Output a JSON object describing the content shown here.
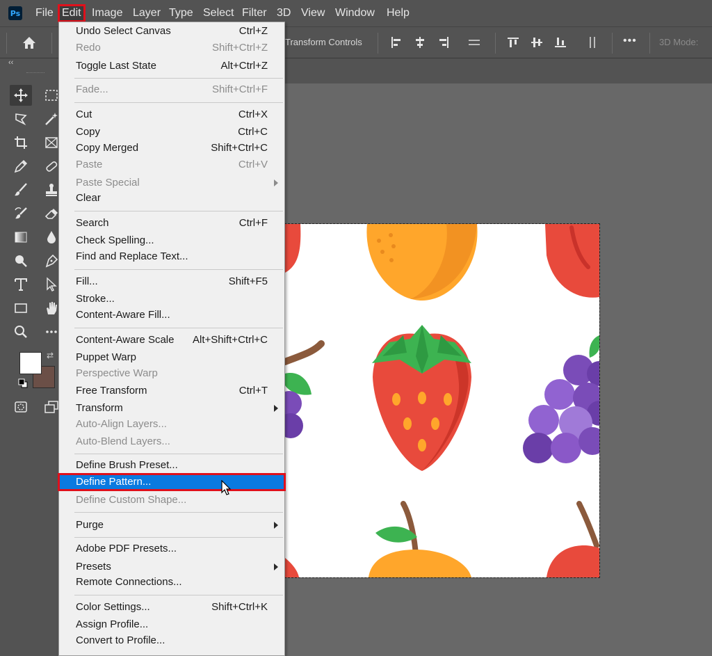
{
  "app": {
    "logo_text": "Ps"
  },
  "menubar": {
    "items": [
      "File",
      "Edit",
      "Image",
      "Layer",
      "Type",
      "Select",
      "Filter",
      "3D",
      "View",
      "Window",
      "Help"
    ],
    "active": "Edit"
  },
  "optionsbar": {
    "transform_controls": "Transform Controls",
    "more": "•••",
    "mode_3d": "3D Mode:"
  },
  "tabstrip": {
    "collapse": "‹‹"
  },
  "colors": {
    "foreground": "#ffffff",
    "background": "#6b4f47",
    "highlight": "#0a7ae0",
    "callout": "#e0101b"
  },
  "edit_menu": {
    "items": [
      {
        "label": "Undo Select Canvas",
        "shortcut": "Ctrl+Z",
        "disabled": false
      },
      {
        "label": "Redo",
        "shortcut": "Shift+Ctrl+Z",
        "disabled": true
      },
      {
        "label": "Toggle Last State",
        "shortcut": "Alt+Ctrl+Z",
        "disabled": false
      },
      {
        "label": "Fade...",
        "shortcut": "Shift+Ctrl+F",
        "disabled": true
      },
      {
        "label": "Cut",
        "shortcut": "Ctrl+X",
        "disabled": false
      },
      {
        "label": "Copy",
        "shortcut": "Ctrl+C",
        "disabled": false
      },
      {
        "label": "Copy Merged",
        "shortcut": "Shift+Ctrl+C",
        "disabled": false
      },
      {
        "label": "Paste",
        "shortcut": "Ctrl+V",
        "disabled": true
      },
      {
        "label": "Paste Special",
        "shortcut": "",
        "disabled": true,
        "submenu": true
      },
      {
        "label": "Clear",
        "shortcut": "",
        "disabled": false
      },
      {
        "label": "Search",
        "shortcut": "Ctrl+F",
        "disabled": false
      },
      {
        "label": "Check Spelling...",
        "shortcut": "",
        "disabled": false
      },
      {
        "label": "Find and Replace Text...",
        "shortcut": "",
        "disabled": false
      },
      {
        "label": "Fill...",
        "shortcut": "Shift+F5",
        "disabled": false
      },
      {
        "label": "Stroke...",
        "shortcut": "",
        "disabled": false
      },
      {
        "label": "Content-Aware Fill...",
        "shortcut": "",
        "disabled": false
      },
      {
        "label": "Content-Aware Scale",
        "shortcut": "Alt+Shift+Ctrl+C",
        "disabled": false
      },
      {
        "label": "Puppet Warp",
        "shortcut": "",
        "disabled": false
      },
      {
        "label": "Perspective Warp",
        "shortcut": "",
        "disabled": true
      },
      {
        "label": "Free Transform",
        "shortcut": "Ctrl+T",
        "disabled": false
      },
      {
        "label": "Transform",
        "shortcut": "",
        "disabled": false,
        "submenu": true
      },
      {
        "label": "Auto-Align Layers...",
        "shortcut": "",
        "disabled": true
      },
      {
        "label": "Auto-Blend Layers...",
        "shortcut": "",
        "disabled": true
      },
      {
        "label": "Define Brush Preset...",
        "shortcut": "",
        "disabled": false
      },
      {
        "label": "Define Pattern...",
        "shortcut": "",
        "disabled": false,
        "highlighted": true
      },
      {
        "label": "Define Custom Shape...",
        "shortcut": "",
        "disabled": true
      },
      {
        "label": "Purge",
        "shortcut": "",
        "disabled": false,
        "submenu": true
      },
      {
        "label": "Adobe PDF Presets...",
        "shortcut": "",
        "disabled": false
      },
      {
        "label": "Presets",
        "shortcut": "",
        "disabled": false,
        "submenu": true
      },
      {
        "label": "Remote Connections...",
        "shortcut": "",
        "disabled": false
      },
      {
        "label": "Color Settings...",
        "shortcut": "Shift+Ctrl+K",
        "disabled": false
      },
      {
        "label": "Assign Profile...",
        "shortcut": "",
        "disabled": false
      },
      {
        "label": "Convert to Profile...",
        "shortcut": "",
        "disabled": false
      }
    ]
  },
  "toolbar": {
    "tools": [
      "move-tool-icon",
      "marquee-tool-icon",
      "lasso-tool-icon",
      "magic-wand-tool-icon",
      "crop-tool-icon",
      "frame-tool-icon",
      "eyedropper-tool-icon",
      "healing-brush-tool-icon",
      "brush-tool-icon",
      "clone-stamp-tool-icon",
      "history-brush-tool-icon",
      "eraser-tool-icon",
      "gradient-tool-icon",
      "blur-tool-icon",
      "dodge-tool-icon",
      "pen-tool-icon",
      "type-tool-icon",
      "path-selection-tool-icon",
      "rectangle-tool-icon",
      "hand-tool-icon",
      "zoom-tool-icon",
      "more-tools-icon",
      "quick-mask-icon",
      "screen-mode-icon"
    ]
  }
}
